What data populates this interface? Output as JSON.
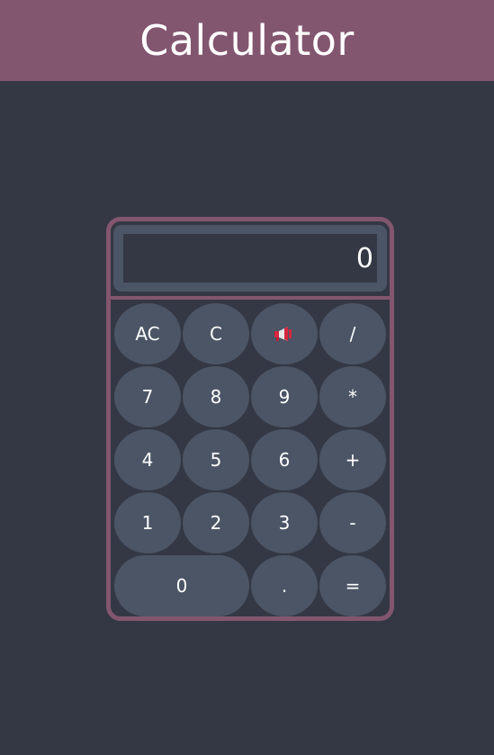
{
  "header": {
    "title": "Calculator"
  },
  "display": {
    "value": "0"
  },
  "colors": {
    "header_bg": "#83566f",
    "page_bg": "#343844",
    "key_bg": "#4b5566",
    "border": "#83566f",
    "speaker_red": "#d7263d"
  },
  "keys": {
    "ac": "AC",
    "c": "C",
    "speaker_icon": "megaphone-icon",
    "divide": "/",
    "seven": "7",
    "eight": "8",
    "nine": "9",
    "multiply": "*",
    "four": "4",
    "five": "5",
    "six": "6",
    "plus": "+",
    "one": "1",
    "two": "2",
    "three": "3",
    "minus": "-",
    "zero": "0",
    "dot": ".",
    "equals": "="
  }
}
